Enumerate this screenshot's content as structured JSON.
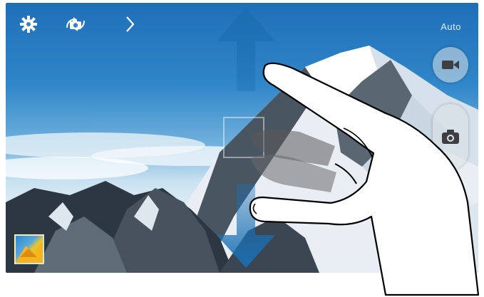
{
  "camera": {
    "mode_label": "Auto",
    "icons": {
      "settings": "gear-icon",
      "switch_camera": "switch-camera-icon",
      "expand": "chevron-right-icon",
      "video": "video-camera-icon",
      "shutter": "camera-icon",
      "mode": "mode-icon",
      "gallery": "gallery-thumbnail"
    }
  },
  "gesture": {
    "type": "drag-vertical",
    "arrow_up": "up-arrow",
    "arrow_down": "down-arrow",
    "hand": "pointing-hand"
  },
  "colors": {
    "arrow": "#1a6fb3",
    "sky_top": "#1f6fb8",
    "sky_bottom": "#dcebf5",
    "button_bg": "#dce1e6"
  }
}
